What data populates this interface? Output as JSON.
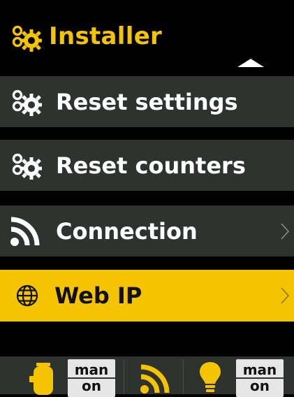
{
  "header": {
    "title": "Installer",
    "icon": "gears-icon",
    "scroll_indicator": "up-arrow-icon"
  },
  "menu": {
    "items": [
      {
        "label": "Reset settings",
        "icon": "gears-icon",
        "has_submenu": false,
        "selected": false
      },
      {
        "label": "Reset counters",
        "icon": "gears-icon",
        "has_submenu": false,
        "selected": false
      },
      {
        "label": "Connection",
        "icon": "rss-feed-icon",
        "has_submenu": true,
        "selected": false
      },
      {
        "label": "Web IP",
        "icon": "globe-icon",
        "has_submenu": true,
        "selected": true
      }
    ]
  },
  "status_bar": {
    "pump": {
      "icon": "pump-icon",
      "mode": "man",
      "state": "on"
    },
    "connection": {
      "icon": "rss-feed-icon"
    },
    "light": {
      "icon": "bulb-icon",
      "mode": "man",
      "state": "on"
    }
  },
  "colors": {
    "accent": "#F5C400",
    "background": "#000000",
    "row_background": "#2F3330",
    "text": "#FFFFFF"
  }
}
